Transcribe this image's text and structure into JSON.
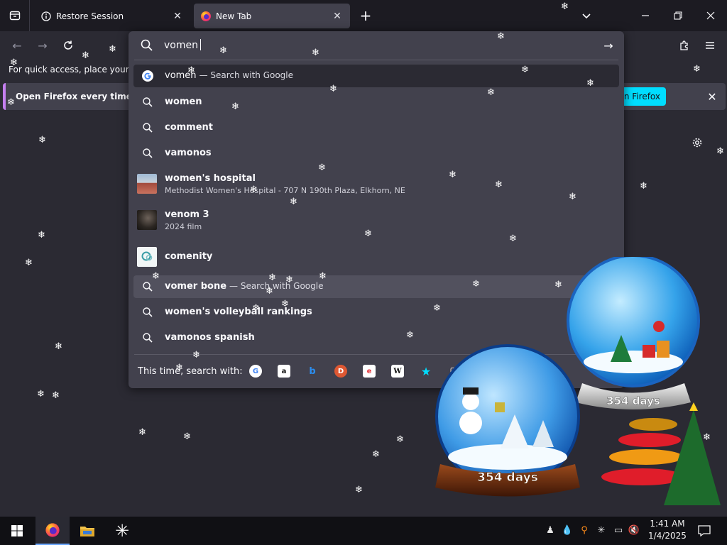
{
  "tabs": [
    {
      "label": "Restore Session",
      "icon": "info-icon",
      "active": false
    },
    {
      "label": "New Tab",
      "icon": "firefox-icon",
      "active": true
    }
  ],
  "page": {
    "bookmarks_hint": "For quick access, place your boo",
    "notice_text": "Open Firefox every time you",
    "notice_button": "n Firefox"
  },
  "urlbar": {
    "query": "vomen",
    "results": [
      {
        "type": "search",
        "icon": "google-icon",
        "title": "vomen",
        "action": "— Search with Google",
        "selected": true
      },
      {
        "type": "suggestion",
        "icon": "search-icon",
        "title": "women"
      },
      {
        "type": "suggestion",
        "icon": "search-icon",
        "title": "comment"
      },
      {
        "type": "suggestion",
        "icon": "search-icon",
        "title": "vamonos"
      },
      {
        "type": "rich",
        "icon": "hospital-thumbnail",
        "title": "women's hospital",
        "subtitle": "Methodist Women's Hospital - 707 N 190th Plaza, Elkhorn, NE"
      },
      {
        "type": "rich",
        "icon": "film-thumbnail",
        "title": "venom 3",
        "subtitle": "2024 film"
      },
      {
        "type": "rich",
        "icon": "comenity-thumbnail",
        "title": "comenity"
      },
      {
        "type": "suggestion",
        "icon": "search-icon",
        "title": "vomer bone",
        "action": "— Search with Google",
        "hovered": true
      },
      {
        "type": "suggestion",
        "icon": "search-icon",
        "title": "women's volleyball rankings"
      },
      {
        "type": "suggestion",
        "icon": "search-icon",
        "title": "vamonos spanish"
      }
    ],
    "oneoff_label": "This time, search with:",
    "oneoff_engines": [
      {
        "name": "google-icon",
        "glyph": "G"
      },
      {
        "name": "amazon-icon",
        "glyph": "a"
      },
      {
        "name": "bing-icon",
        "glyph": "b"
      },
      {
        "name": "duckduckgo-icon",
        "glyph": "D"
      },
      {
        "name": "ebay-icon",
        "glyph": "e"
      },
      {
        "name": "wikipedia-icon",
        "glyph": "W"
      },
      {
        "name": "bookmarks-star-icon",
        "glyph": "★"
      },
      {
        "name": "tabs-icon",
        "glyph": "▢"
      }
    ]
  },
  "desktop": {
    "globe_small_label": "354 days",
    "globe_large_label": "354 days"
  },
  "taskbar": {
    "time": "1:41 AM",
    "date": "1/4/2025"
  },
  "colors": {
    "accent": "#00ddff",
    "notice_border": "#c57ff0",
    "panel": "#42414d",
    "background": "#2b2a33"
  }
}
